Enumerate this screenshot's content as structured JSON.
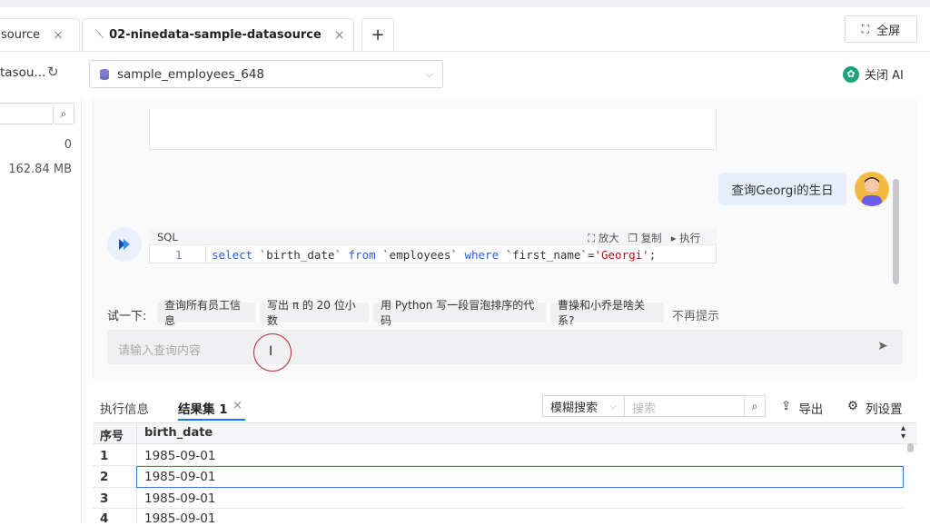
{
  "tabs": [
    {
      "label": "source",
      "close": "×"
    },
    {
      "label": "02-ninedata-sample-datasource",
      "close": "×"
    }
  ],
  "add_tab": "+",
  "fullscreen_label": "全屏",
  "datasource_label": "tasou...",
  "database_select": "sample_employees_648",
  "close_ai_label": "关闭 AI",
  "left_panel": {
    "count": "0",
    "size": "162.84 MB"
  },
  "chat": {
    "user_message": "查询Georgi的生日",
    "sql_header": "SQL",
    "sql_actions": {
      "zoom": "放大",
      "copy": "复制",
      "run": "执行"
    },
    "sql_line_no": "1",
    "sql_tokens": {
      "kw_select": "select",
      "col": " `birth_date` ",
      "kw_from": "from",
      "table": " `employees` ",
      "kw_where": "where",
      "cond": " `first_name`=",
      "str": "'Georgi'",
      "end": ";"
    }
  },
  "suggestions": {
    "label": "试一下:",
    "items": [
      "查询所有员工信息",
      "写出 π 的 20 位小数",
      "用 Python 写一段冒泡排序的代码",
      "曹操和小乔是啥关系?"
    ],
    "dismiss": "不再提示"
  },
  "input": {
    "placeholder": "请输入查询内容"
  },
  "results": {
    "tabs": {
      "info": "执行信息",
      "result": "结果集 1",
      "close": "×"
    },
    "search_mode": "模糊搜索",
    "search_placeholder": "搜索",
    "export": "导出",
    "column_settings": "列设置",
    "headers": {
      "index": "序号",
      "col": "birth_date"
    },
    "rows": [
      {
        "index": "1",
        "value": "1985-09-01"
      },
      {
        "index": "2",
        "value": "1985-09-01"
      },
      {
        "index": "3",
        "value": "1985-09-01"
      },
      {
        "index": "4",
        "value": "1985-09-01"
      }
    ]
  },
  "colors": {
    "accent": "#3a7bd5",
    "tab_underline": "#1677ff",
    "bubble": "#e6eefc",
    "cursor_ring": "#b3262a"
  }
}
